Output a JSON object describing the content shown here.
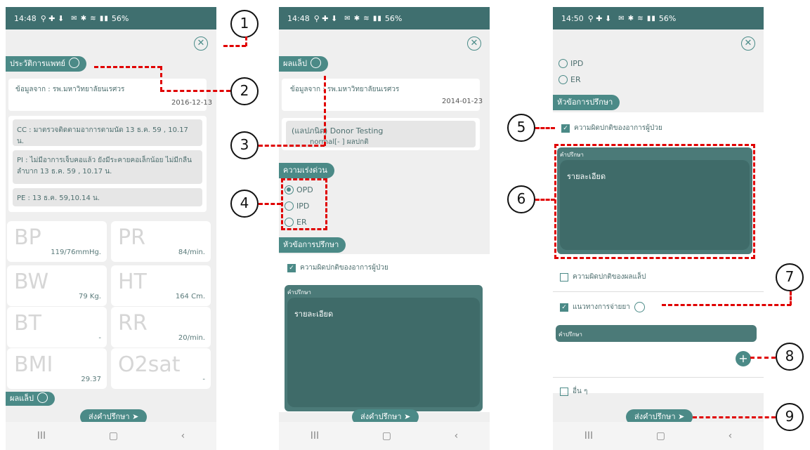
{
  "screen1": {
    "time": "14:48",
    "status": "56%",
    "section_label": "ประวัติการแพทย์",
    "source": "ข้อมูลจาก : รพ.มหาวิทยาลัยนเรศวร",
    "date": "2016-12-13",
    "cc": "CC : มาตรวจติดตามอาการตามนัด  13 ธ.ค. 59 , 10.17 น.",
    "pi": "PI :  ไม่มีอาการเจ็บคอแล้ว ยังมีระคายคอเล็กน้อย  ไม่มีกลืนลำบาก      13 ธ.ค. 59 , 10.17 น.",
    "pe": "PE : 13 ธ.ค. 59,10.14 น.",
    "vitals": [
      {
        "label": "BP",
        "value": "119/76mmHg."
      },
      {
        "label": "PR",
        "value": "84/min."
      },
      {
        "label": "BW",
        "value": "79 Kg."
      },
      {
        "label": "HT",
        "value": "164 Cm."
      },
      {
        "label": "BT",
        "value": "-"
      },
      {
        "label": "RR",
        "value": "20/min."
      },
      {
        "label": "BMI",
        "value": "29.37"
      },
      {
        "label": "O2sat",
        "value": "-"
      }
    ],
    "lab_label": "ผลแล็ป",
    "send_label": "ส่งคำปรึกษา"
  },
  "screen2": {
    "time": "14:48",
    "status": "56%",
    "section_label": "ผลแล็ป",
    "source": "ข้อมูลจาก : รพ.มหาวิทยาลัยนเรศวร",
    "date": "2014-01-23",
    "lab_title": "(แลปภนิต) Donor Testing",
    "lab_result": "normal[- ] ผลปกติ",
    "urgency_label": "ความเร่งด่วน",
    "options": [
      "OPD",
      "IPD",
      "ER"
    ],
    "topic_label": "หัวข้อการปรึกษา",
    "check1": "ความผิดปกติของอาการผู้ป่วย",
    "consult_head": "คำปรึกษา",
    "consult_text": "รายละเอียด",
    "send_label": "ส่งคำปรึกษา"
  },
  "screen3": {
    "time": "14:50",
    "status": "56%",
    "options": [
      "IPD",
      "ER"
    ],
    "topic_label": "หัวข้อการปรึกษา",
    "check1": "ความผิดปกติของอาการผู้ป่วย",
    "consult_head": "คำปรึกษา",
    "consult_text": "รายละเอียด",
    "check2": "ความผิดปกติของผลแล็ป",
    "check3": "แนวทางการจ่ายยา",
    "consult_head2": "คำปรึกษา",
    "check4": "อื่น ๆ",
    "send_label": "ส่งคำปรึกษา"
  },
  "nav": [
    "III",
    "▢",
    "‹"
  ],
  "callouts": [
    "1",
    "2",
    "3",
    "4",
    "5",
    "6",
    "7",
    "8",
    "9"
  ],
  "colors": {
    "accent": "#4b8a87",
    "statusbar": "#3f6f6f",
    "annotation": "#e00000"
  }
}
